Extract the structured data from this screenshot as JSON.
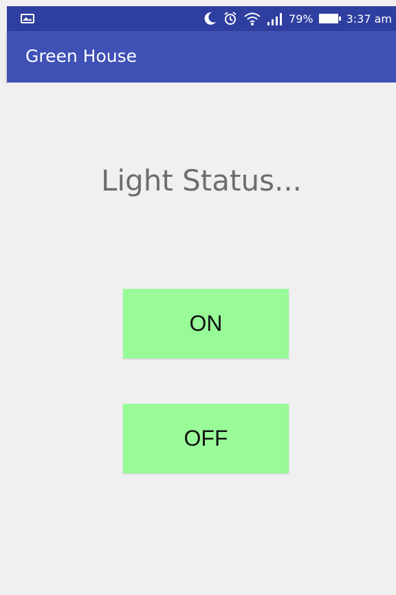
{
  "status_bar": {
    "left_icon": "image-icon",
    "icons": [
      "moon-icon",
      "alarm-icon",
      "wifi-icon",
      "signal-icon",
      "battery-icon"
    ],
    "battery_percent": "79%",
    "time": "3:37 am"
  },
  "app_bar": {
    "title": "Green House"
  },
  "main": {
    "headline": "Light Status...",
    "buttons": {
      "on_label": "ON",
      "off_label": "OFF"
    }
  },
  "colors": {
    "status_bar": "#2f3f9f",
    "app_bar": "#3f51b5",
    "background": "#f0f0f0",
    "button_fill": "#98fb98",
    "headline_text": "#6d6d6d"
  }
}
